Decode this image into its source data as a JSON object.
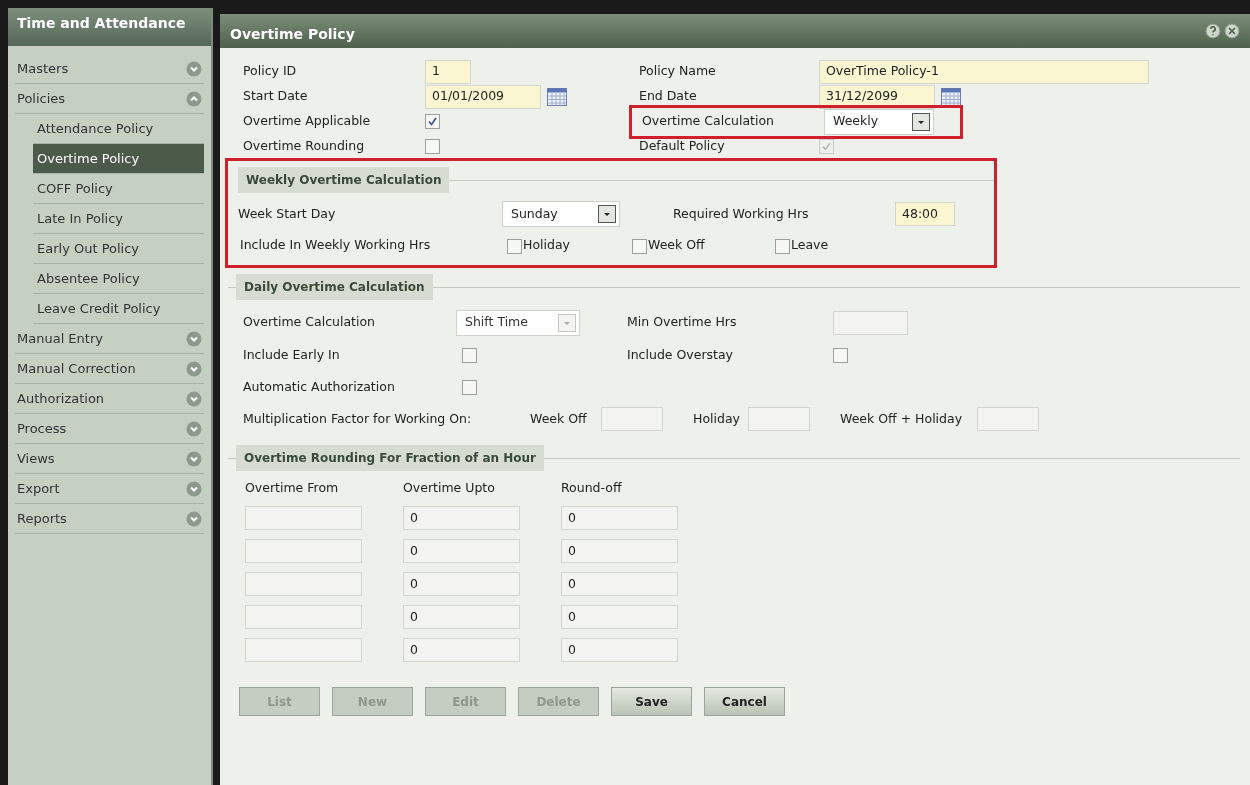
{
  "sidebar": {
    "title": "Time and Attendance",
    "items": [
      {
        "label": "Masters",
        "expanded": false
      },
      {
        "label": "Policies",
        "expanded": true,
        "children": [
          {
            "label": "Attendance Policy",
            "selected": false
          },
          {
            "label": "Overtime Policy",
            "selected": true
          },
          {
            "label": "COFF Policy",
            "selected": false
          },
          {
            "label": "Late In Policy",
            "selected": false
          },
          {
            "label": "Early Out Policy",
            "selected": false
          },
          {
            "label": "Absentee Policy",
            "selected": false
          },
          {
            "label": "Leave Credit Policy",
            "selected": false
          }
        ]
      },
      {
        "label": "Manual Entry",
        "expanded": false
      },
      {
        "label": "Manual Correction",
        "expanded": false
      },
      {
        "label": "Authorization",
        "expanded": false
      },
      {
        "label": "Process",
        "expanded": false
      },
      {
        "label": "Views",
        "expanded": false
      },
      {
        "label": "Export",
        "expanded": false
      },
      {
        "label": "Reports",
        "expanded": false
      }
    ]
  },
  "dialog": {
    "title": "Overtime Policy"
  },
  "general": {
    "fields": [
      {
        "label": "Policy ID",
        "kind": "text",
        "value": "1"
      },
      {
        "label": "Policy Name",
        "kind": "text",
        "value": "OverTime Policy-1"
      },
      {
        "label": "Start Date",
        "kind": "date",
        "value": "01/01/2009"
      },
      {
        "label": "End Date",
        "kind": "date",
        "value": "31/12/2099"
      },
      {
        "label": "Overtime Applicable",
        "kind": "checkbox",
        "checked": true,
        "disabled": false
      },
      {
        "label": "Overtime Calculation",
        "kind": "select",
        "value": "Weekly",
        "highlighted": true
      },
      {
        "label": "Overtime Rounding",
        "kind": "checkbox",
        "checked": false,
        "disabled": false
      },
      {
        "label": "Default Policy",
        "kind": "checkbox",
        "checked": true,
        "disabled": true
      }
    ]
  },
  "weekly": {
    "title": "Weekly Overtime Calculation",
    "highlighted": true,
    "week_start_day": {
      "label": "Week Start Day",
      "value": "Sunday"
    },
    "required_hrs": {
      "label": "Required Working Hrs",
      "value": "48:00"
    },
    "include": {
      "label": "Include In Weekly Working Hrs",
      "options": [
        {
          "label": "Holiday",
          "checked": false
        },
        {
          "label": "Week Off",
          "checked": false
        },
        {
          "label": "Leave",
          "checked": false
        }
      ]
    }
  },
  "daily": {
    "title": "Daily Overtime Calculation",
    "overtime_calculation": {
      "label": "Overtime Calculation",
      "value": "Shift Time",
      "disabled": true
    },
    "min_overtime": {
      "label": "Min Overtime Hrs"
    },
    "include_early_in": {
      "label": "Include Early In",
      "checked": false
    },
    "include_overstay": {
      "label": "Include Overstay",
      "checked": false
    },
    "automatic_authorization": {
      "label": "Automatic Authorization",
      "checked": false
    },
    "multiplication": {
      "label": "Multiplication Factor for Working On:",
      "factors": [
        {
          "label": "Week Off"
        },
        {
          "label": "Holiday"
        },
        {
          "label": "Week Off + Holiday"
        }
      ]
    }
  },
  "rounding": {
    "title": "Overtime Rounding For Fraction of an Hour",
    "columns": [
      "Overtime From",
      "Overtime Upto",
      "Round-off"
    ],
    "rows": [
      {
        "upto": "0",
        "round_off": "0"
      },
      {
        "upto": "0",
        "round_off": "0"
      },
      {
        "upto": "0",
        "round_off": "0"
      },
      {
        "upto": "0",
        "round_off": "0"
      },
      {
        "upto": "0",
        "round_off": "0"
      }
    ]
  },
  "buttons": [
    {
      "label": "List",
      "disabled": true
    },
    {
      "label": "New",
      "disabled": true
    },
    {
      "label": "Edit",
      "disabled": true
    },
    {
      "label": "Delete",
      "disabled": true
    },
    {
      "label": "Save",
      "disabled": false
    },
    {
      "label": "Cancel",
      "disabled": false
    }
  ]
}
